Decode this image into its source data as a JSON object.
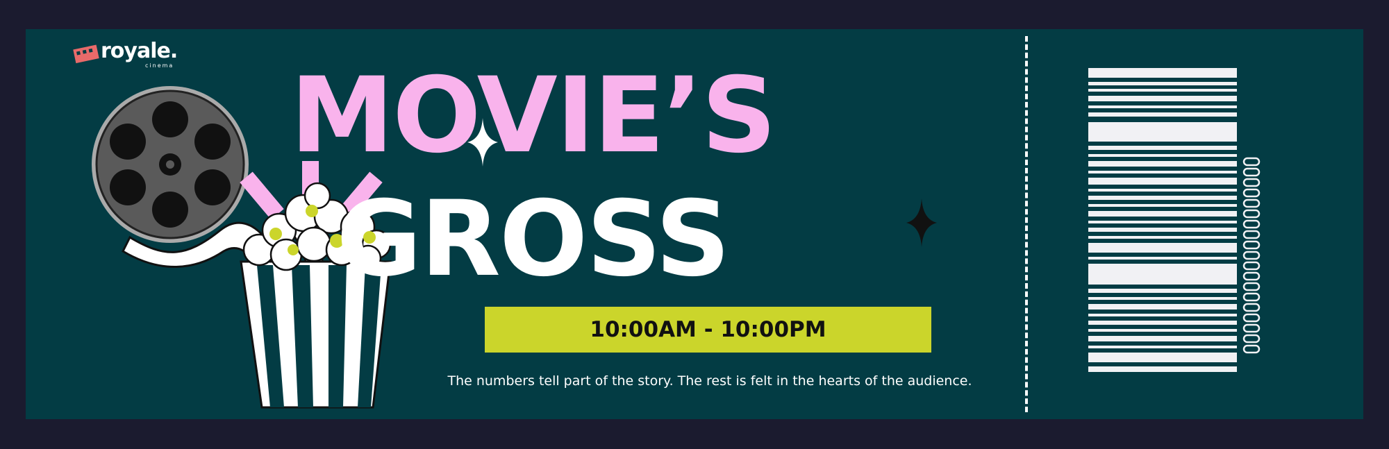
{
  "brand": {
    "logo_word": "royale.",
    "logo_sub": "cinema"
  },
  "title": {
    "line1": "MOVIE’S",
    "line2": "GROSS"
  },
  "hours": "10:00AM - 10:00PM",
  "tagline": "The numbers tell part of the story. The rest is felt in the hearts of the audience.",
  "colors": {
    "background": "#1b1b2f",
    "ticket": "#033c44",
    "accent_pink": "#f9b3ec",
    "accent_lime": "#cbd52b",
    "barcode": "#f1f1f4"
  },
  "icons": [
    "film-reel-icon",
    "popcorn-bucket-icon",
    "sparkle-icon",
    "barcode-icon"
  ]
}
